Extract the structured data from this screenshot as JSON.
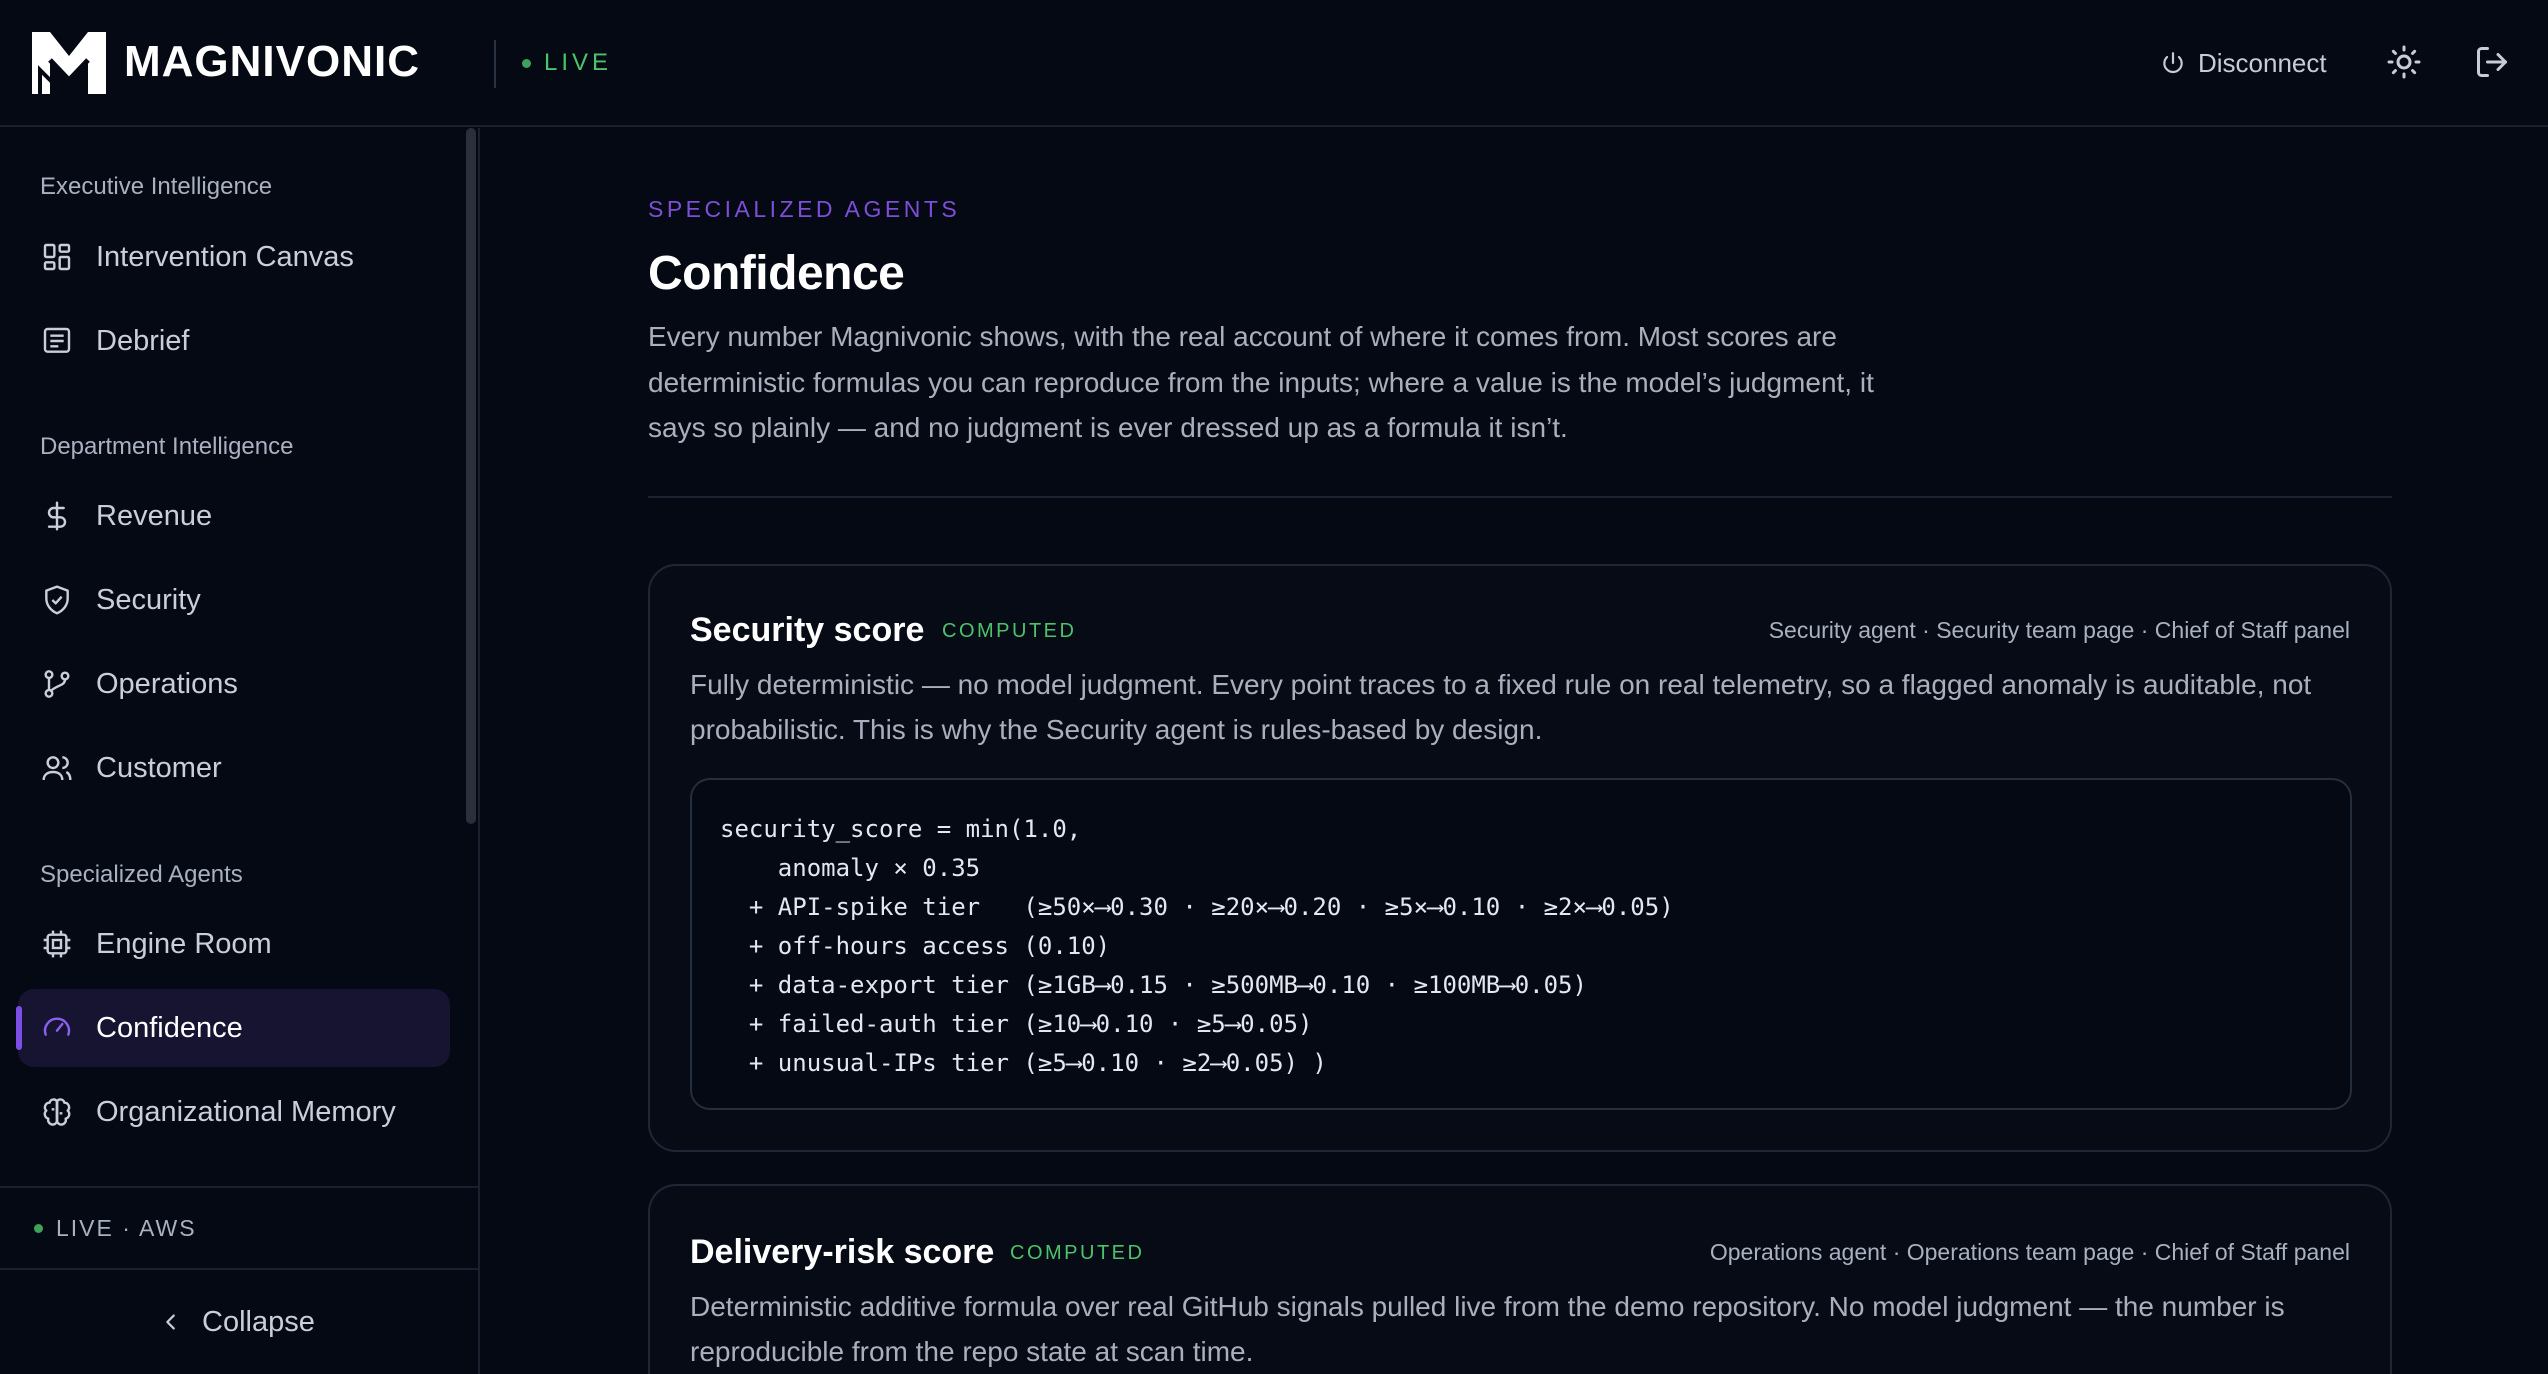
{
  "app": {
    "brand": "MAGNIVONIC",
    "live_label": "LIVE"
  },
  "topbar": {
    "disconnect_label": "Disconnect",
    "icons": [
      "power-icon",
      "sun-icon",
      "logout-icon"
    ]
  },
  "sidebar": {
    "sections": [
      {
        "title": "Executive Intelligence",
        "items": [
          {
            "label": "Intervention Canvas",
            "icon": "layout-grid-icon"
          },
          {
            "label": "Debrief",
            "icon": "message-square-text-icon"
          }
        ]
      },
      {
        "title": "Department Intelligence",
        "items": [
          {
            "label": "Revenue",
            "icon": "dollar-icon"
          },
          {
            "label": "Security",
            "icon": "shield-check-icon"
          },
          {
            "label": "Operations",
            "icon": "git-branch-icon"
          },
          {
            "label": "Customer",
            "icon": "users-icon"
          }
        ]
      },
      {
        "title": "Specialized Agents",
        "items": [
          {
            "label": "Engine Room",
            "icon": "cpu-icon"
          },
          {
            "label": "Confidence",
            "icon": "gauge-icon",
            "active": true
          },
          {
            "label": "Organizational Memory",
            "icon": "brain-icon"
          }
        ]
      }
    ],
    "status_label": "LIVE · AWS",
    "collapse_label": "Collapse"
  },
  "main": {
    "eyebrow": "SPECIALIZED AGENTS",
    "title": "Confidence",
    "description": "Every number Magnivonic shows, with the real account of where it comes from. Most scores are deterministic formulas you can reproduce from the inputs; where a value is the model’s judgment, it says so plainly — and no judgment is ever dressed up as a formula it isn’t.",
    "cards": [
      {
        "title": "Security score",
        "badge": "COMPUTED",
        "meta": "Security agent · Security team page · Chief of Staff panel",
        "description": "Fully deterministic — no model judgment. Every point traces to a fixed rule on real telemetry, so a flagged anomaly is auditable, not probabilistic. This is why the Security agent is rules-based by design.",
        "code": [
          "security_score = min(1.0,",
          "    anomaly × 0.35",
          "  + API-spike tier   (≥50×⟶0.30 · ≥20×⟶0.20 · ≥5×⟶0.10 · ≥2×⟶0.05)",
          "  + off-hours access (0.10)",
          "  + data-export tier (≥1GB⟶0.15 · ≥500MB⟶0.10 · ≥100MB⟶0.05)",
          "  + failed-auth tier (≥10⟶0.10 · ≥5⟶0.05)",
          "  + unusual-IPs tier (≥5⟶0.10 · ≥2⟶0.05) )"
        ]
      },
      {
        "title": "Delivery-risk score",
        "badge": "COMPUTED",
        "meta": "Operations agent · Operations team page · Chief of Staff panel",
        "description": "Deterministic additive formula over real GitHub signals pulled live from the demo repository. No model judgment — the number is reproducible from the repo state at scan time."
      }
    ]
  },
  "colors": {
    "background": "#050914",
    "accent_purple": "#7b4fe6",
    "live_green": "#4cc26a",
    "text_muted": "#a9afbd"
  }
}
